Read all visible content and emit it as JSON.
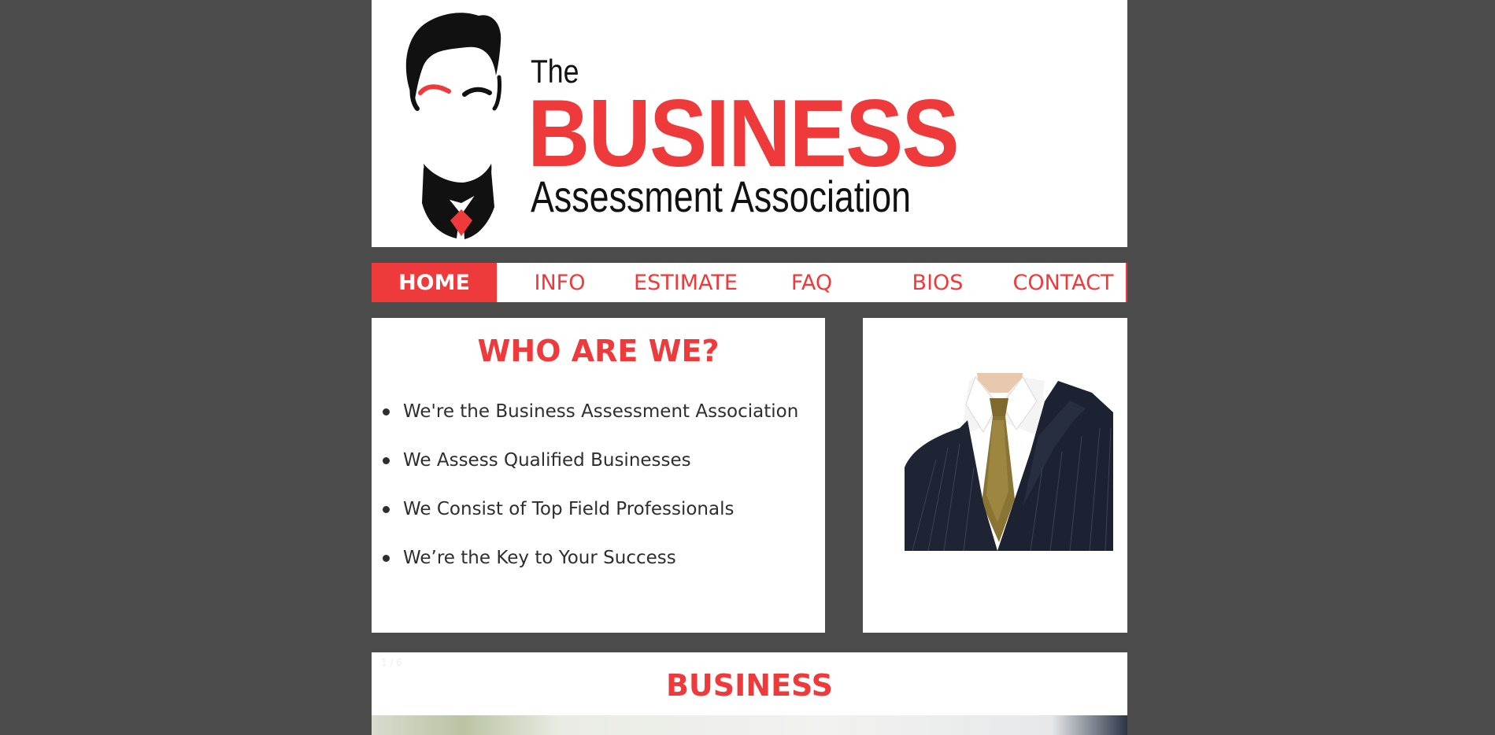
{
  "logo": {
    "the": "The",
    "business": "BUSINESS",
    "subtitle": "Assessment Association"
  },
  "nav": {
    "items": [
      {
        "label": "HOME",
        "active": true
      },
      {
        "label": "INFO",
        "active": false
      },
      {
        "label": "ESTIMATE",
        "active": false
      },
      {
        "label": "FAQ",
        "active": false
      },
      {
        "label": "BIOS",
        "active": false
      },
      {
        "label": "CONTACT",
        "active": false
      }
    ]
  },
  "who": {
    "title": "WHO ARE WE?",
    "points": [
      "We're the Business Assessment Association",
      "We Assess Qualified Businesses",
      "We Consist of Top Field Professionals",
      "We’re the Key to Your Success"
    ]
  },
  "slider": {
    "counter": "1 / 6",
    "title": "BUSINESS"
  },
  "colors": {
    "accent": "#ee3a3b",
    "background": "#4b4b4b",
    "card": "#ffffff",
    "text": "#2e2e2e"
  }
}
